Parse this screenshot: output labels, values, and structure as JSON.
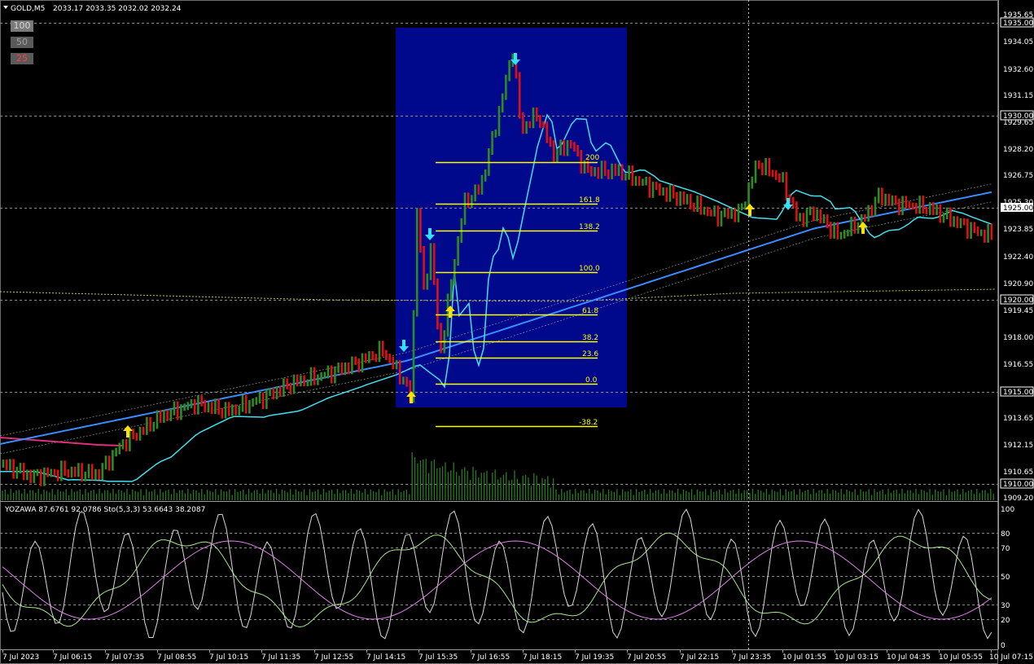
{
  "header": {
    "symbol": "GOLD,M5",
    "ohlc": "2033.17 2033.35 2032.02 2032.24",
    "collapse_icon": "triangle-down-icon"
  },
  "zoom_buttons": [
    "100",
    "50",
    "25"
  ],
  "price_axis": {
    "labels": [
      "1935.65",
      "1934.05",
      "1932.60",
      "1931.15",
      "1929.65",
      "1928.20",
      "1926.75",
      "1925.30",
      "1923.85",
      "1922.40",
      "1920.90",
      "1919.45",
      "1918.00",
      "1916.55",
      "1915.05",
      "1913.65",
      "1912.15",
      "1910.65",
      "1909.20"
    ],
    "boxed": [
      "1935.00",
      "1930.00",
      "1925.00",
      "1920.00",
      "1915.00",
      "1910.00"
    ],
    "highlight": "1925.00"
  },
  "fibonacci": {
    "levels": [
      "200",
      "161.8",
      "138.2",
      "100.0",
      "61.8",
      "38.2",
      "23.6",
      "0.0",
      "-38.2"
    ]
  },
  "indicator": {
    "title": "YOZAWA 87.6761 92.0786  Sto(5,3,3) 53.6643 38.2087",
    "axis": [
      "100",
      "80",
      "70",
      "50",
      "30",
      "20",
      "0"
    ]
  },
  "time_axis": [
    "7 Jul 2023",
    "7 Jul 06:15",
    "7 Jul 07:35",
    "7 Jul 08:55",
    "7 Jul 10:15",
    "7 Jul 11:35",
    "7 Jul 12:55",
    "7 Jul 14:15",
    "7 Jul 15:35",
    "7 Jul 16:55",
    "7 Jul 18:15",
    "7 Jul 19:35",
    "7 Jul 20:55",
    "7 Jul 22:15",
    "7 Jul 23:35",
    "10 Jul 01:55",
    "10 Jul 03:15",
    "10 Jul 04:35",
    "10 Jul 05:55",
    "10 Jul 07:15"
  ],
  "colors": {
    "bull": "#2e8b23",
    "bear": "#e01010",
    "fib_box": "#00088c",
    "fib_line": "#ffff00",
    "ma_fast": "#40e0f0",
    "ma_slow": "#3a8cff",
    "ma_pink": "#e0307a",
    "arrow_up": "#ffe000",
    "arrow_down": "#30e0ff",
    "grid": "#8a8a8a"
  }
}
